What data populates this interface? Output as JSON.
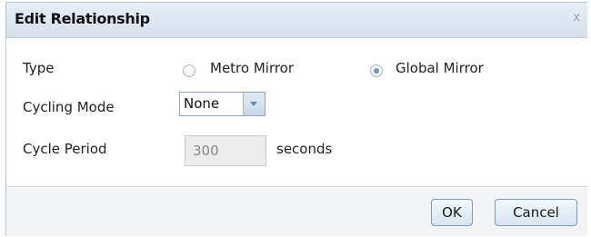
{
  "dialog": {
    "title": "Edit Relationship",
    "close_glyph": "x"
  },
  "type": {
    "label": "Type",
    "options": [
      {
        "label": "Metro Mirror",
        "selected": false
      },
      {
        "label": "Global Mirror",
        "selected": true
      }
    ]
  },
  "cycling_mode": {
    "label": "Cycling Mode",
    "value": "None"
  },
  "cycle_period": {
    "label": "Cycle Period",
    "value": "300",
    "unit": "seconds"
  },
  "footer": {
    "ok_label": "OK",
    "cancel_label": "Cancel"
  },
  "icons": {
    "close": "close-icon",
    "dropdown": "chevron-down-icon"
  },
  "colors": {
    "title_bar": "#dbe4ee",
    "accent": "#6e95bd",
    "footer_bg": "#f3f4f5"
  }
}
